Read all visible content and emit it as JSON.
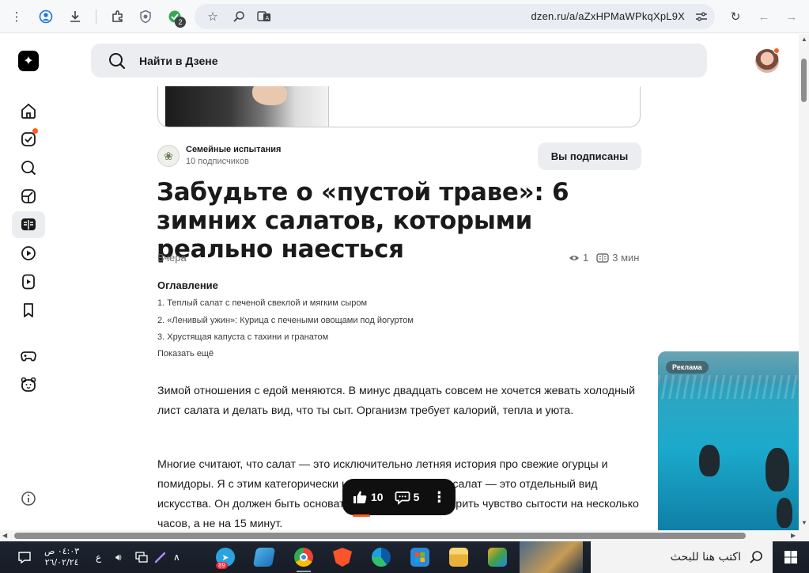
{
  "browser": {
    "url": "dzen.ru/a/aZxHPMaWPkqXpL9X",
    "extensions_badge": "2"
  },
  "header": {
    "search_placeholder": "Найти в Дзене"
  },
  "article": {
    "channel_name": "Семейные испытания",
    "channel_subscribers": "10 подписчиков",
    "subscribed_label": "Вы подписаны",
    "title": "Забудьте о «пустой траве»: 6 зимних салатов, которыми реально наесться",
    "date": "Вчера",
    "views": "1",
    "read_time": "3 мин",
    "toc_title": "Оглавление",
    "toc_items": [
      "1. Теплый салат с печеной свеклой и мягким сыром",
      "2. «Ленивый ужин»: Курица с печеными овощами под йогуртом",
      "3. Хрустящая капуста с тахини и гранатом"
    ],
    "toc_more": "Показать ещё",
    "paragraphs": [
      "Зимой отношения с едой меняются. В минус двадцать совсем не хочется жевать холодный лист салата и делать вид, что ты сыт. Организм требует калорий, тепла и уюта.",
      "Многие считают, что салат — это исключительно летняя история про свежие огурцы и помидоры. Я с этим категорически не согласна. Зимний салат — это отдельный вид искусства. Он должен быть основательным, теплым и дарить чувство сытости на несколько часов, а не на 15 минут."
    ]
  },
  "actions": {
    "likes": "10",
    "comments": "5"
  },
  "ad": {
    "label": "Реклама"
  },
  "taskbar": {
    "search_text": "اكتب هنا للبحث",
    "time": "٠٤:٠٣ ص",
    "date": "٢٦/٠٢/٢٤",
    "lang": "ع",
    "telegram_badge": "89"
  },
  "colors": {
    "accent": "#ff5a1f",
    "pill_bg": "#0f0f10",
    "search_bg": "#ecedf0"
  }
}
